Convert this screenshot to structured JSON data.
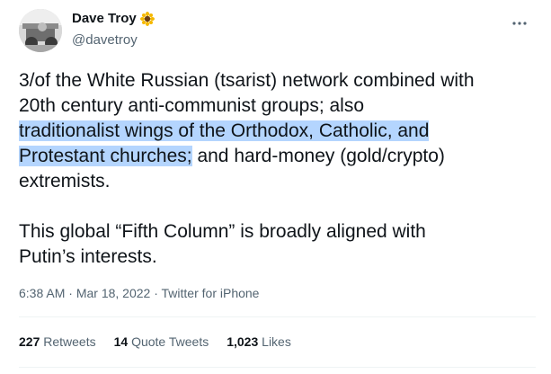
{
  "author": {
    "name": "Dave Troy",
    "name_emoji": "sunflower-icon",
    "handle": "@davetroy"
  },
  "tweet": {
    "line1_a": "3/of the White Russian (tsarist) network combined with",
    "line1_b": "20th century anti-communist groups; also",
    "line1_hl1": "traditionalist wings of the Orthodox, Catholic, and",
    "line1_hl2": "Protestant churches;",
    "line1_c": " and hard-money (gold/crypto)",
    "line1_d": "extremists.",
    "para2_a": "This global “Fifth Column” is broadly aligned with",
    "para2_b": "Putin’s interests."
  },
  "meta": {
    "time": "6:38 AM",
    "sep1": " · ",
    "date": "Mar 18, 2022",
    "sep2": " · ",
    "source": "Twitter for iPhone"
  },
  "stats": {
    "retweets_count": "227",
    "retweets_label": "Retweets",
    "quotes_count": "14",
    "quotes_label": "Quote Tweets",
    "likes_count": "1,023",
    "likes_label": "Likes"
  },
  "colors": {
    "text": "#0f1419",
    "secondary": "#536471",
    "highlight": "#b4d5fe",
    "divider": "#eff3f4"
  }
}
